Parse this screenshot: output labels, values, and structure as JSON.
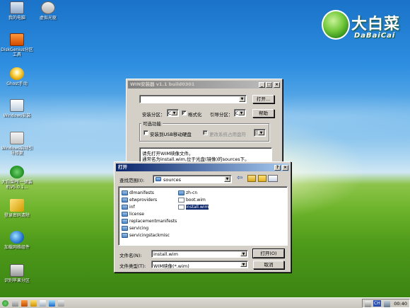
{
  "desktop_icons": [
    {
      "label": "我的电脑",
      "icon": "computer-icon"
    },
    {
      "label": "虚拟光驱",
      "icon": "virtual-drive-icon"
    },
    {
      "label": "DiskGenius分区工具",
      "icon": "diskgenius-icon"
    },
    {
      "label": "Ghost手动",
      "icon": "ghost-icon"
    },
    {
      "label": "Windows安装",
      "icon": "windows-install-icon"
    },
    {
      "label": "Windows启动引导修复",
      "icon": "boot-repair-icon"
    },
    {
      "label": "大白菜PE一键装机V5.0.1...",
      "icon": "dabaicai-install-icon"
    },
    {
      "label": "登录密码清除",
      "icon": "key-icon"
    },
    {
      "label": "加载网络组件",
      "icon": "network-globe-icon"
    },
    {
      "label": "识别苹果分区",
      "icon": "drive-icon"
    }
  ],
  "logo": {
    "cn": "大白菜",
    "en": "DaBaiCai"
  },
  "installer": {
    "title": "WIN安装器 v1.1 build0301",
    "open_button": "打开...",
    "install_partition_label": "安装分区：",
    "install_partition_value": "C",
    "format_label": "格式化",
    "boot_partition_label": "引导分区：",
    "boot_partition_value": "C",
    "help_button": "帮助",
    "optional_group": "可选功能",
    "usb_label": "安装到USB移动硬盘",
    "change_drive_label": "更改系统占用盘符",
    "change_drive_value": "D",
    "info_line1": "请先打开WIM映像文件。",
    "info_line2": "通常名为install.wim,位于光盘(镜像)的sources下。"
  },
  "open_dialog": {
    "title": "打开",
    "look_in_label": "查找范围(I):",
    "look_in_value": "sources",
    "left_column": [
      "dlmanifests",
      "etwproviders",
      "inf",
      "license",
      "replacementmanifests",
      "servicing",
      "servicingstackmisc"
    ],
    "right_column": [
      {
        "name": "zh-cn",
        "type": "folder"
      },
      {
        "name": "boot.wim",
        "type": "file"
      },
      {
        "name": "install.wim",
        "type": "file",
        "selected": true
      }
    ],
    "filename_label": "文件名(N):",
    "filename_value": "install.wim",
    "filetype_label": "文件类型(T):",
    "filetype_value": "WIM映像(*.wim)",
    "open_button": "打开(O)",
    "cancel_button": "取消"
  },
  "taskbar": {
    "ime": "CH",
    "clock": "00:40"
  }
}
